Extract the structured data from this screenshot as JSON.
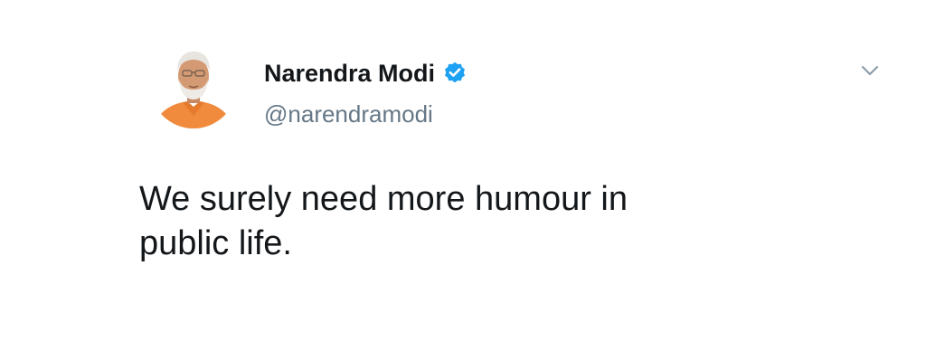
{
  "tweet": {
    "author": {
      "display_name": "Narendra Modi",
      "handle": "@narendramodi",
      "verified": true,
      "avatar_icon": "profile-photo"
    },
    "text": "We surely need more humour in\npublic life.",
    "menu_icon": "chevron-down-icon"
  },
  "colors": {
    "verified_badge": "#1da1f2",
    "handle": "#657786",
    "text": "#14171a",
    "avatar_saffron": "#f08a3c"
  }
}
